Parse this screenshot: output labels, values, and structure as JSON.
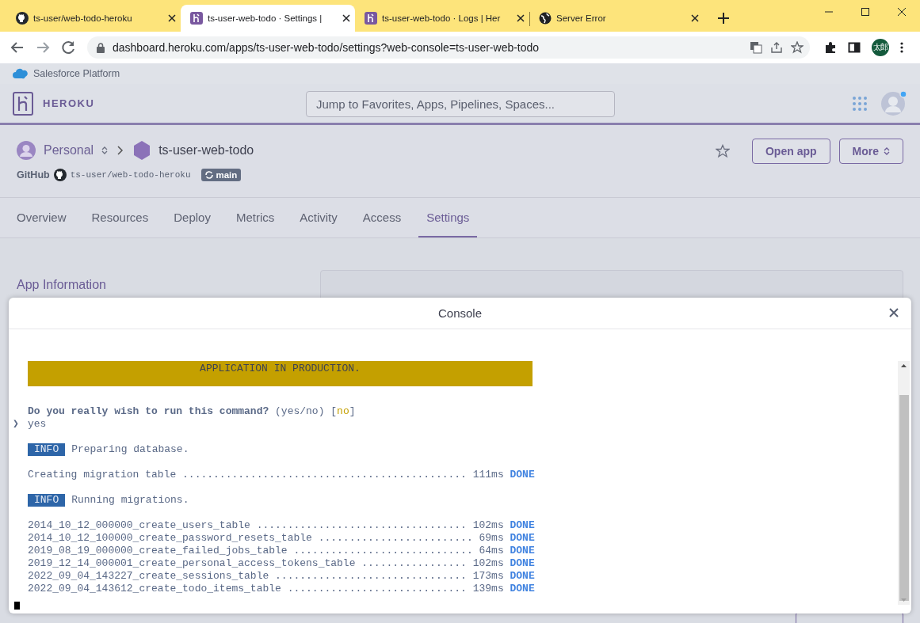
{
  "browser": {
    "tabs": [
      {
        "title": "ts-user/web-todo-heroku",
        "kind": "repo",
        "selected": false
      },
      {
        "title": "ts-user-web-todo · Settings |",
        "kind": "app",
        "selected": true
      },
      {
        "title": "ts-user-web-todo · Logs | Her",
        "kind": "app",
        "selected": false
      },
      {
        "title": "Server Error",
        "kind": "site",
        "selected": false
      }
    ],
    "address": "dashboard.heroku.com/apps/ts-user-web-todo/settings?web-console=ts-user-web-todo",
    "profile": "太郎"
  },
  "platform_bar": {
    "label": "Salesforce Platform"
  },
  "header": {
    "brand": "HEROKU",
    "search": {
      "placeholder": "Jump to Favorites, Apps, Pipelines, Spaces..."
    }
  },
  "app": {
    "owner": "Personal",
    "name": "ts-user-web-todo",
    "repo_label": "GitHub",
    "repo": "ts-user/web-todo-heroku",
    "branch": "main",
    "buttons": [
      {
        "label": "Open app",
        "kind": "plain"
      },
      {
        "label": "More",
        "kind": "menu"
      }
    ]
  },
  "nav": [
    {
      "label": "Overview",
      "selected": false
    },
    {
      "label": "Resources",
      "selected": false
    },
    {
      "label": "Deploy",
      "selected": false
    },
    {
      "label": "Metrics",
      "selected": false
    },
    {
      "label": "Activity",
      "selected": false
    },
    {
      "label": "Access",
      "selected": false
    },
    {
      "label": "Settings",
      "selected": true
    }
  ],
  "settings": {
    "title": "App Information"
  },
  "console": {
    "title": "Console",
    "banner": "APPLICATION IN PRODUCTION.",
    "lines": [
      {
        "kind": "question",
        "text": "Do you really wish to run this command?",
        "hint": "(yes/no)",
        "bracket_open": "[",
        "default": "no",
        "bracket_close": "]"
      },
      {
        "kind": "input",
        "prompt": "❯",
        "text": "yes"
      },
      {
        "kind": "info",
        "badge": "INFO",
        "text": "Preparing database."
      },
      {
        "kind": "task",
        "text": "Creating migration table .............................................. 111ms",
        "status": "DONE"
      },
      {
        "kind": "info",
        "badge": "INFO",
        "text": "Running migrations."
      },
      {
        "kind": "task",
        "text": "2014_10_12_000000_create_users_table .................................. 102ms",
        "status": "DONE"
      },
      {
        "kind": "task",
        "text": "2014_10_12_100000_create_password_resets_table ......................... 69ms",
        "status": "DONE"
      },
      {
        "kind": "task",
        "text": "2019_08_19_000000_create_failed_jobs_table ............................. 64ms",
        "status": "DONE"
      },
      {
        "kind": "task",
        "text": "2019_12_14_000001_create_personal_access_tokens_table ................. 102ms",
        "status": "DONE"
      },
      {
        "kind": "task",
        "text": "2022_09_04_143227_create_sessions_table ............................... 173ms",
        "status": "DONE"
      },
      {
        "kind": "task",
        "text": "2022_09_04_143612_create_todo_items_table ............................. 139ms",
        "status": "DONE"
      }
    ]
  }
}
